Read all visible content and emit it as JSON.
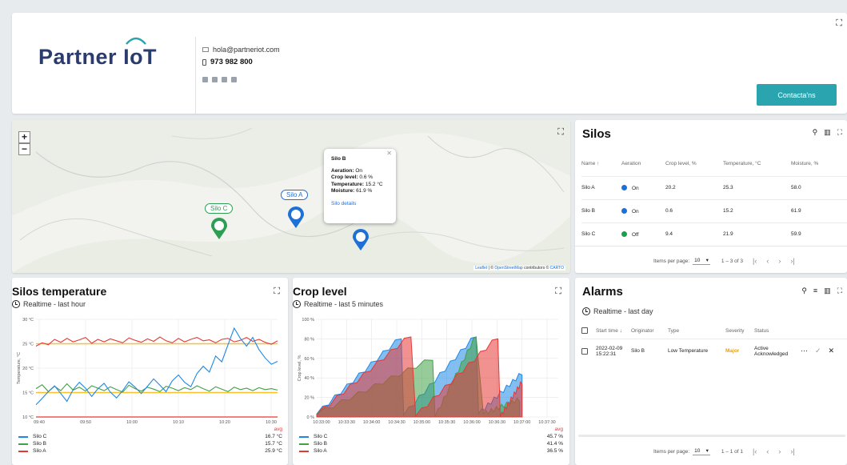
{
  "header": {
    "brand": "Partner",
    "brand_iot": "IoT",
    "email": "hola@partneriot.com",
    "phone": "973 982 800",
    "contact_button": "Contacta'ns"
  },
  "map": {
    "labels": [
      "Silo C",
      "Silo A"
    ],
    "popup": {
      "title": "Silo B",
      "aeration_label": "Aeration:",
      "aeration_value": "On",
      "crop_label": "Crop level:",
      "crop_value": "0.6 %",
      "temp_label": "Temperature:",
      "temp_value": "15.2 °C",
      "moist_label": "Moisture:",
      "moist_value": "61.9 %",
      "link": "Silo details"
    },
    "attribution": [
      "Leaflet",
      " | © ",
      "OpenStreetMap",
      " contributors © ",
      "CARTO"
    ]
  },
  "silos": {
    "title": "Silos",
    "columns": [
      "Name ↑",
      "Aeration",
      "Crop level, %",
      "Temperature, °C",
      "Moisture, %"
    ],
    "rows": [
      {
        "name": "Silo A",
        "aeration": "On",
        "color": "#1e6fd6",
        "crop": "20.2",
        "temp": "25.3",
        "moist": "58.0"
      },
      {
        "name": "Silo B",
        "aeration": "On",
        "color": "#1e6fd6",
        "crop": "0.6",
        "temp": "15.2",
        "moist": "61.9"
      },
      {
        "name": "Silo C",
        "aeration": "Off",
        "color": "#1e9e4a",
        "crop": "9.4",
        "temp": "21.9",
        "moist": "59.9"
      }
    ],
    "pager": {
      "label": "Items per page:",
      "value": "10",
      "range": "1 – 3 of 3"
    }
  },
  "temp_chart": {
    "title": "Silos temperature",
    "subtitle": "Realtime - last hour",
    "ylabel": "Temperature, °C",
    "yticks": [
      "30 °C",
      "25 °C",
      "20 °C",
      "15 °C",
      "10 °C"
    ],
    "xticks": [
      "09:40",
      "09:50",
      "10:00",
      "10:10",
      "10:20",
      "10:30"
    ],
    "avg": "avg",
    "legend": [
      {
        "name": "Silo C",
        "value": "16.7 °C",
        "color": "#1e88e5"
      },
      {
        "name": "Silo B",
        "value": "15.7 °C",
        "color": "#43a047"
      },
      {
        "name": "Silo A",
        "value": "25.9 °C",
        "color": "#e53935"
      }
    ]
  },
  "crop_chart": {
    "title": "Crop level",
    "subtitle": "Realtime - last 5 minutes",
    "ylabel": "Crop level, %",
    "yticks": [
      "100 %",
      "80 %",
      "60 %",
      "40 %",
      "20 %",
      "0 %"
    ],
    "xticks": [
      "10:33:00",
      "10:33:30",
      "10:34:00",
      "10:34:30",
      "10:35:00",
      "10:35:30",
      "10:36:00",
      "10:36:30",
      "10:37:00",
      "10:37:30"
    ],
    "avg": "avg",
    "legend": [
      {
        "name": "Silo C",
        "value": "45.7 %",
        "color": "#1e88e5"
      },
      {
        "name": "Silo B",
        "value": "41.4 %",
        "color": "#43a047"
      },
      {
        "name": "Silo A",
        "value": "36.5 %",
        "color": "#e53935"
      }
    ]
  },
  "alarms": {
    "title": "Alarms",
    "subtitle": "Realtime - last day",
    "columns": [
      "Start time ↓",
      "Originator",
      "Type",
      "Severity",
      "Status"
    ],
    "row": {
      "date": "2022-02-09",
      "time": "15:22:31",
      "originator": "Silo B",
      "type": "Low Temperature",
      "severity": "Major",
      "status1": "Active",
      "status2": "Acknowledged"
    },
    "pager": {
      "label": "Items per page:",
      "value": "10",
      "range": "1 – 1 of 1"
    }
  },
  "chart_data": [
    {
      "type": "line",
      "title": "Silos temperature",
      "ylabel": "Temperature, °C",
      "ylim": [
        10,
        30
      ],
      "x_range": [
        "09:37",
        "10:36"
      ],
      "series": [
        {
          "name": "Silo A",
          "color": "#e53935",
          "values": [
            24.5,
            25.2,
            24.8,
            25.9,
            25.3,
            26.1,
            25.4,
            25.8,
            26.3,
            25.1,
            25.9,
            25.4,
            26.0,
            25.6,
            25.2,
            26.2,
            25.7,
            25.3,
            26.0,
            25.5,
            26.4,
            25.6,
            25.2,
            26.1,
            25.4,
            25.9,
            26.3,
            25.6,
            25.8,
            25.2,
            25.9,
            26.1,
            25.4,
            25.7,
            26.3,
            25.5,
            25.9,
            25.3,
            24.9,
            25.6
          ]
        },
        {
          "name": "Silo B",
          "color": "#43a047",
          "values": [
            15.8,
            16.6,
            15.2,
            16.3,
            15.4,
            16.8,
            15.5,
            16.1,
            15.3,
            16.4,
            15.9,
            15.4,
            16.2,
            15.6,
            15.1,
            16.5,
            15.8,
            15.3,
            16.1,
            15.7,
            15.2,
            16.3,
            15.9,
            15.4,
            16.0,
            15.6,
            16.4,
            15.8,
            15.3,
            16.2,
            15.7,
            15.2,
            16.1,
            15.6,
            15.9,
            15.4,
            16.0,
            15.6,
            15.8,
            15.5
          ]
        },
        {
          "name": "Silo C",
          "color": "#1e88e5",
          "values": [
            12.5,
            13.8,
            15.2,
            16.4,
            14.8,
            13.2,
            15.6,
            17.1,
            15.9,
            14.2,
            15.8,
            16.9,
            15.1,
            13.9,
            15.4,
            17.2,
            16.1,
            14.8,
            16.3,
            17.8,
            16.5,
            15.2,
            17.4,
            18.6,
            17.1,
            16.2,
            18.9,
            20.4,
            19.2,
            22.5,
            21.3,
            24.8,
            28.2,
            26.1,
            24.5,
            26.3,
            23.8,
            22.1,
            20.8,
            21.4
          ]
        }
      ],
      "bands": [
        {
          "value": 25,
          "color": "#fbc02d"
        },
        {
          "value": 15,
          "color": "#fbc02d"
        }
      ]
    },
    {
      "type": "area",
      "title": "Crop level",
      "ylabel": "Crop level, %",
      "ylim": [
        0,
        100
      ],
      "x_range": [
        "10:32:55",
        "10:37:55"
      ],
      "series": [
        {
          "name": "Silo C",
          "color": "#1e88e5",
          "points": [
            [
              0,
              3
            ],
            [
              0.35,
              82
            ],
            [
              0.36,
              2
            ],
            [
              0.66,
              84
            ],
            [
              0.67,
              3
            ],
            [
              0.85,
              45
            ]
          ]
        },
        {
          "name": "Silo B",
          "color": "#43a047",
          "points": [
            [
              0,
              3
            ],
            [
              0.48,
              60
            ],
            [
              0.49,
              0
            ],
            [
              0.66,
              84
            ],
            [
              0.69,
              3
            ],
            [
              0.84,
              18
            ]
          ]
        },
        {
          "name": "Silo A",
          "color": "#e53935",
          "points": [
            [
              0,
              2
            ],
            [
              0.39,
              84
            ],
            [
              0.41,
              1
            ],
            [
              0.75,
              82
            ],
            [
              0.76,
              0
            ],
            [
              0.85,
              36
            ]
          ]
        }
      ]
    }
  ]
}
